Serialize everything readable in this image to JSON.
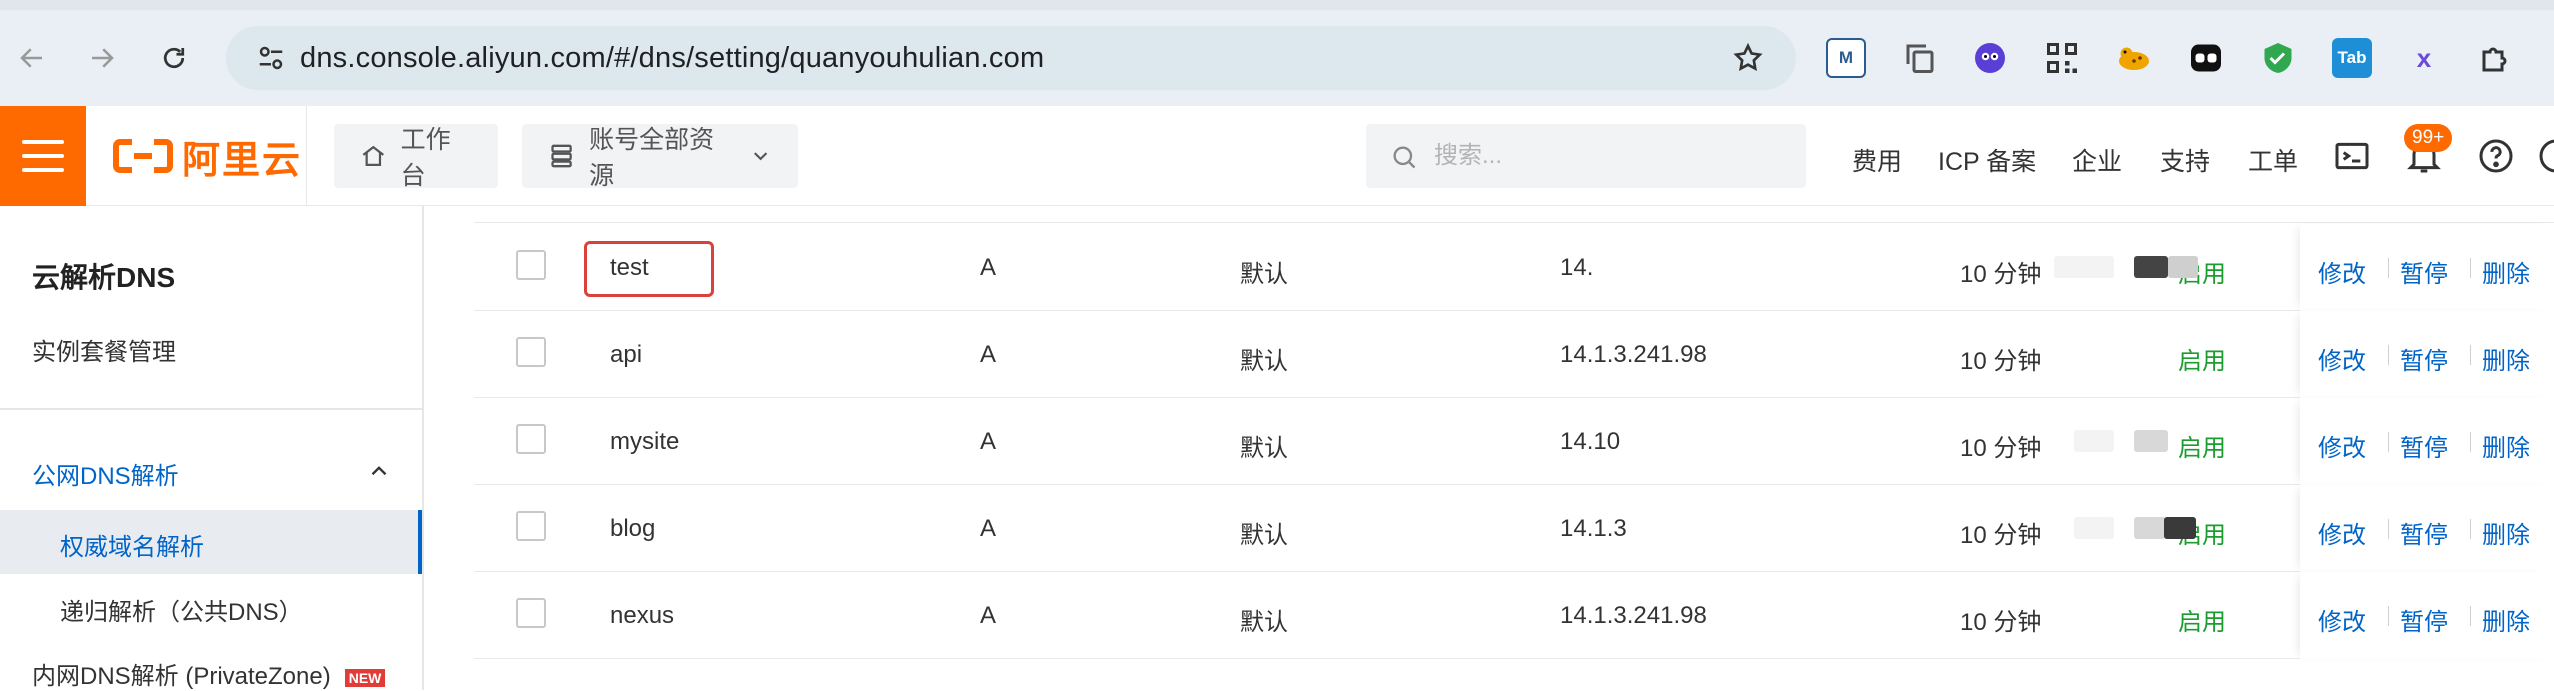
{
  "browser": {
    "url": "dns.console.aliyun.com/#/dns/setting/quanyouhulian.com",
    "extensions": [
      {
        "name": "m-extension-icon",
        "label": "M",
        "color": "#2a5d8f"
      },
      {
        "name": "copy-extension-icon",
        "label": "",
        "color": "#555555"
      },
      {
        "name": "face-extension-icon",
        "label": "",
        "color": "#5a3fd6"
      },
      {
        "name": "qr-extension-icon",
        "label": "",
        "color": "#333333"
      },
      {
        "name": "leopard-extension-icon",
        "label": "",
        "color": "#f0a400"
      },
      {
        "name": "bear-extension-icon",
        "label": "",
        "color": "#111111"
      },
      {
        "name": "shield-extension-icon",
        "label": "",
        "color": "#2fa84f"
      },
      {
        "name": "tab-extension-icon",
        "label": "Tab",
        "color": "#1e8fd6"
      },
      {
        "name": "x-extension-icon",
        "label": "x",
        "color": "#6a4bd8"
      },
      {
        "name": "puzzle-extension-icon",
        "label": "",
        "color": "#333333"
      }
    ]
  },
  "topbar": {
    "logo_text": "阿里云",
    "workbench": "工作台",
    "resources": "账号全部资源",
    "search_placeholder": "搜索...",
    "links": [
      "费用",
      "ICP 备案",
      "企业",
      "支持",
      "工单"
    ],
    "notification_badge": "99+",
    "brand_color": "#ff6a00"
  },
  "sidebar": {
    "title": "云解析DNS",
    "instance_management": "实例套餐管理",
    "group_public": "公网DNS解析",
    "active_item": "权威域名解析",
    "recursive": "递归解析（公共DNS）",
    "private_zone": "内网DNS解析 (PrivateZone)",
    "new_badge": "NEW",
    "accent_color": "#0064c8"
  },
  "table": {
    "rows": [
      {
        "host": "test",
        "type": "A",
        "line": "默认",
        "value": "14.",
        "ttl": "10 分钟",
        "status": "启用"
      },
      {
        "host": "api",
        "type": "A",
        "line": "默认",
        "value": "14.1.3.241.98",
        "ttl": "10 分钟",
        "status": "启用"
      },
      {
        "host": "mysite",
        "type": "A",
        "line": "默认",
        "value": "14.10",
        "ttl": "10 分钟",
        "status": "启用"
      },
      {
        "host": "blog",
        "type": "A",
        "line": "默认",
        "value": "14.1.3",
        "ttl": "10 分钟",
        "status": "启用"
      },
      {
        "host": "nexus",
        "type": "A",
        "line": "默认",
        "value": "14.1.3.241.98",
        "ttl": "10 分钟",
        "status": "启用"
      }
    ],
    "actions": {
      "edit": "修改",
      "pause": "暂停",
      "delete": "删除"
    },
    "status_color": "#1a9c2e"
  }
}
